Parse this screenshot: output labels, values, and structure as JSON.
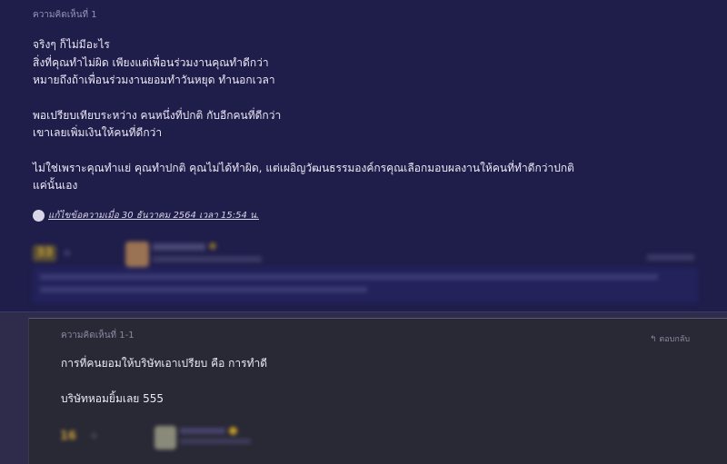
{
  "comment1": {
    "header": "ความคิดเห็นที่ 1",
    "paragraphs": [
      [
        "จริงๆ ก็ไม่มีอะไร",
        "สิ่งที่คุณทำไม่ผิด เพียงแต่เพื่อนร่วมงานคุณทำดีกว่า",
        "หมายถึงถ้าเพื่อนร่วมงานยอมทำวันหยุด ทำนอกเวลา"
      ],
      [
        "พอเปรียบเทียบระหว่าง คนหนึ่งที่ปกติ กับอีกคนที่ดีกว่า",
        "เขาเลยเพิ่มเงินให้คนที่ดีกว่า"
      ],
      [
        "ไม่ใช่เพราะคุณทำแย่ คุณทำปกติ คุณไม่ได้ทำผิด, แต่เผอิญวัฒนธรรมองค์กรคุณเลือกมอบผลงานให้คนที่ทำดีกว่าปกติ",
        "แค่นั้นเอง"
      ]
    ],
    "edited": "แก้ไขข้อความเมื่อ 30 ธันวาคม 2564 เวลา 15:54 น.",
    "votes": "33",
    "plus": "+",
    "reply_label": ""
  },
  "comment2": {
    "header": "ความคิดเห็นที่ 1-1",
    "paragraphs": [
      [
        "การที่คนยอมให้บริษัทเอาเปรียบ คือ การทำดี"
      ],
      [
        "บริษัทหอมยิ้มเลย 555"
      ]
    ],
    "votes": "16",
    "plus": "+",
    "reply_label": "↰ ตอบกลับ"
  }
}
